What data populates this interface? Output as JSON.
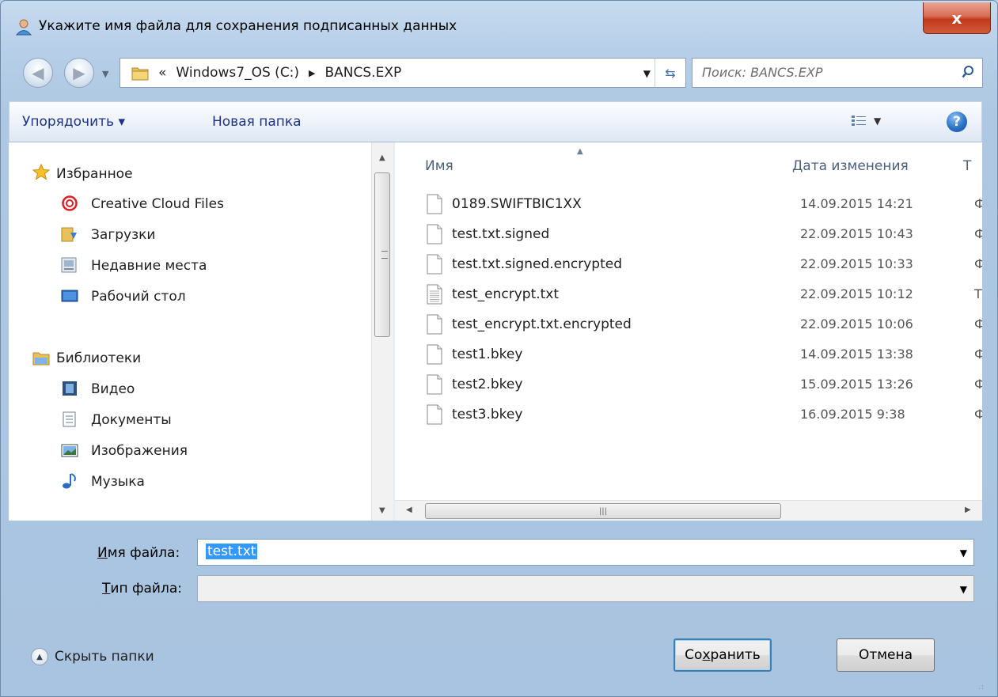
{
  "window": {
    "title": "Укажите имя файла для сохранения подписанных данных",
    "close_label": "x"
  },
  "address": {
    "overflow": "«",
    "crumbs": [
      "Windows7_OS (C:)",
      "BANCS.EXP"
    ]
  },
  "search": {
    "placeholder": "Поиск: BANCS.EXP"
  },
  "toolbar": {
    "organize": "Упорядочить ▾",
    "new_folder": "Новая папка"
  },
  "nav": {
    "favorites": "Избранное",
    "creative_cloud": "Creative Cloud Files",
    "downloads": "Загрузки",
    "recent": "Недавние места",
    "desktop": "Рабочий стол",
    "libraries": "Библиотеки",
    "video": "Видео",
    "documents": "Документы",
    "images": "Изображения",
    "music": "Музыка"
  },
  "columns": {
    "name": "Имя",
    "date": "Дата изменения",
    "type": "Т"
  },
  "files": [
    {
      "name": "0189.SWIFTBIC1XX",
      "date": "14.09.2015 14:21",
      "type": "Ф",
      "icon": "blank-file-icon"
    },
    {
      "name": "test.txt.signed",
      "date": "22.09.2015 10:43",
      "type": "Ф",
      "icon": "blank-file-icon"
    },
    {
      "name": "test.txt.signed.encrypted",
      "date": "22.09.2015 10:33",
      "type": "Ф",
      "icon": "blank-file-icon"
    },
    {
      "name": "test_encrypt.txt",
      "date": "22.09.2015 10:12",
      "type": "Т",
      "icon": "text-file-icon"
    },
    {
      "name": "test_encrypt.txt.encrypted",
      "date": "22.09.2015 10:06",
      "type": "Ф",
      "icon": "blank-file-icon"
    },
    {
      "name": "test1.bkey",
      "date": "14.09.2015 13:38",
      "type": "Ф",
      "icon": "blank-file-icon"
    },
    {
      "name": "test2.bkey",
      "date": "15.09.2015 13:26",
      "type": "Ф",
      "icon": "blank-file-icon"
    },
    {
      "name": "test3.bkey",
      "date": "16.09.2015 9:38",
      "type": "Ф",
      "icon": "blank-file-icon"
    }
  ],
  "form": {
    "filename_label_u": "И",
    "filename_label_rest": "мя файла:",
    "filename_value": "test.txt",
    "filetype_label_u": "Т",
    "filetype_label_rest": "ип файла:",
    "filetype_value": ""
  },
  "footer": {
    "hide_folders": "Скрыть папки",
    "save_pre": "Со",
    "save_u": "х",
    "save_post": "ранить",
    "cancel": "Отмена"
  },
  "colors": {
    "selection": "#3399ff",
    "link_text": "#1e3287",
    "close_button": "#c2391c"
  }
}
